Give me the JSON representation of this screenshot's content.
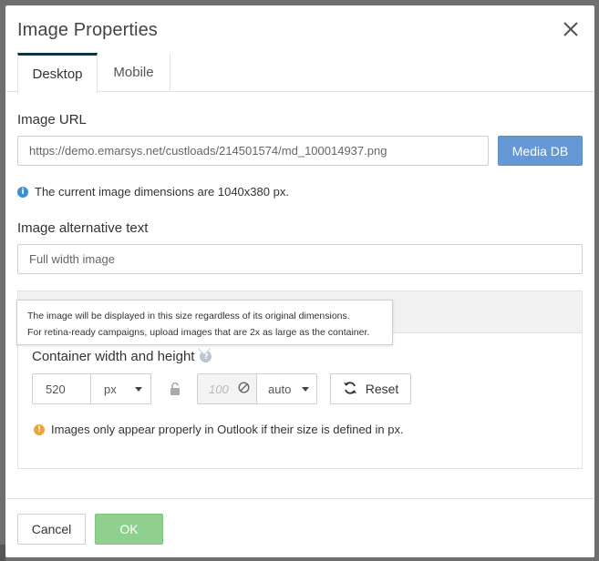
{
  "dialog": {
    "title": "Image Properties",
    "close_icon": "close-icon"
  },
  "tabs": [
    {
      "label": "Desktop",
      "active": true
    },
    {
      "label": "Mobile",
      "active": false
    }
  ],
  "image_url": {
    "label": "Image URL",
    "value": "https://demo.emarsys.net/custloads/214501574/md_100014937.png",
    "media_button": "Media DB"
  },
  "dimensions_info": {
    "icon": "info-icon",
    "text": "The current image dimensions are 1040x380 px."
  },
  "alt_text": {
    "label": "Image alternative text",
    "placeholder": "Full width image"
  },
  "tooltip": {
    "line1": "The image will be displayed in this size regardless of its original dimensions.",
    "line2": "For retina-ready campaigns, upload images that are 2x as large as the container."
  },
  "container": {
    "label": "Container width and height",
    "help_icon": "question-icon",
    "width_value": "520",
    "width_unit": "px",
    "lock_icon": "unlock-icon",
    "height_placeholder": "100",
    "height_unit": "auto",
    "reset_label": "Reset",
    "reset_icon": "refresh-icon"
  },
  "warning": {
    "icon": "warning-icon",
    "text": "Images only appear properly in Outlook if their size is defined in px."
  },
  "footer": {
    "cancel_label": "Cancel",
    "ok_label": "OK"
  },
  "colors": {
    "primary": "#6698d6",
    "ok": "#8fd08f",
    "tab_accent": "#0d3340",
    "info": "#3a8fd6",
    "warning": "#f0a23a"
  }
}
